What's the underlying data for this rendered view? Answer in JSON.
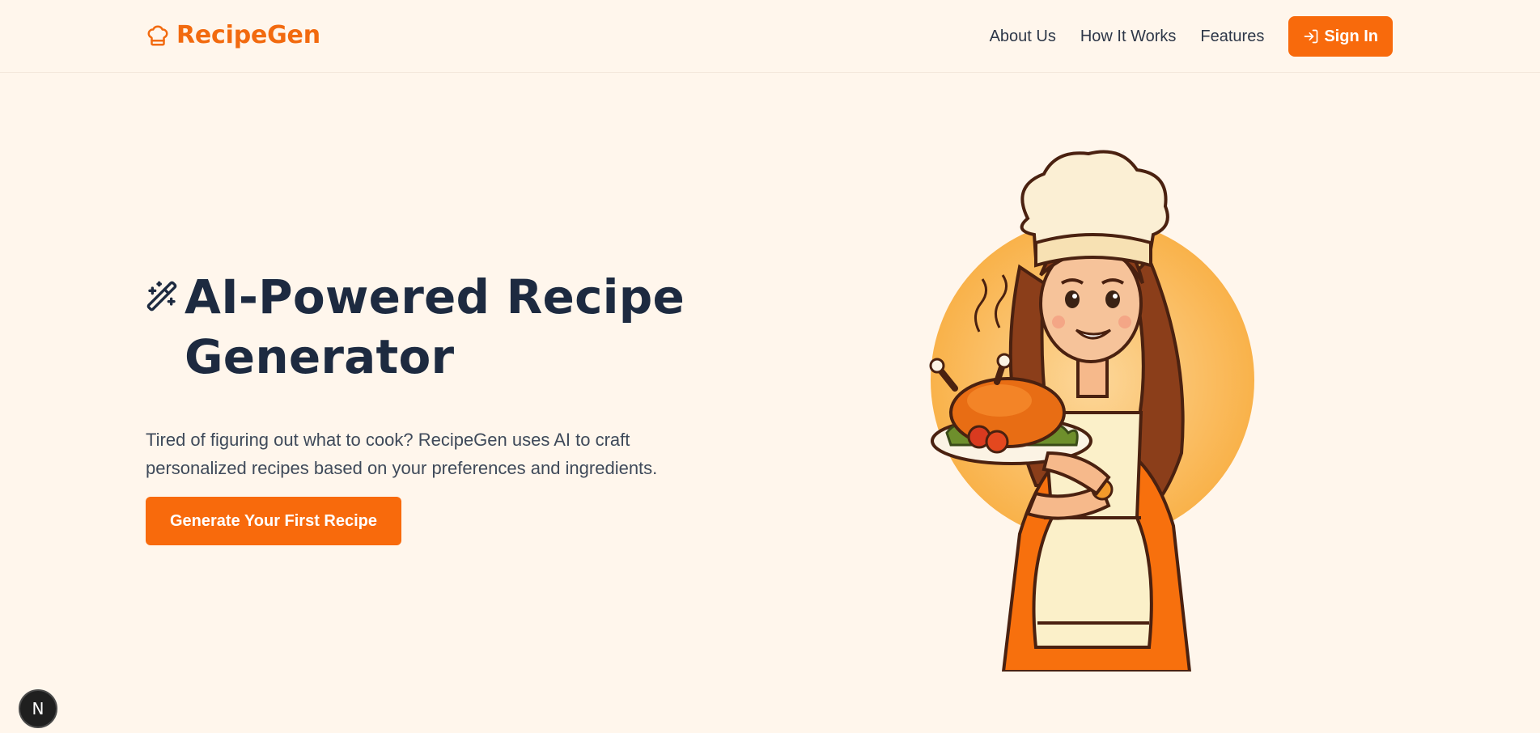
{
  "brand": {
    "name": "RecipeGen",
    "icon": "chef-hat-icon",
    "color": "#f26a0f"
  },
  "nav": {
    "links": [
      "About Us",
      "How It Works",
      "Features"
    ],
    "sign_in_label": "Sign In",
    "sign_in_icon": "log-in-icon"
  },
  "hero": {
    "title_line1": "AI-Powered Recipe",
    "title_line2": "Generator",
    "title_icon": "magic-wand-icon",
    "subtitle_line1": "Tired of figuring out what to cook? RecipeGen uses AI to craft",
    "subtitle_line2": "personalized recipes based on your preferences and ingredients.",
    "cta_label": "Generate Your First Recipe",
    "illustration": "chef-holding-roast-chicken-illustration"
  },
  "dev_badge": {
    "label": "N",
    "icon": "nextjs-icon"
  },
  "colors": {
    "accent": "#f86a0c",
    "background": "#fff6ec",
    "heading": "#1d2a40"
  }
}
